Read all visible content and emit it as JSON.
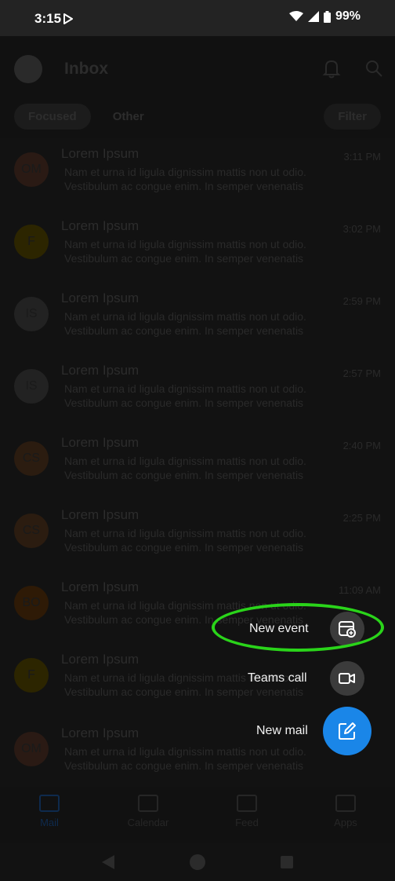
{
  "status_bar": {
    "time": "3:15",
    "battery": "99%"
  },
  "header": {
    "title": "Inbox",
    "tabs": [
      "Focused",
      "Other"
    ],
    "filter_label": "Filter"
  },
  "messages": [
    {
      "initials": "OM",
      "sender": "Lorem Ipsum",
      "time": "3:11 PM",
      "line1": "Nam et urna id ligula dignissim mattis non ut odio.",
      "line2": "Vestibulum ac congue enim. In semper venenatis",
      "color": "#2a1a14"
    },
    {
      "initials": "F",
      "sender": "Lorem Ipsum",
      "time": "3:02 PM",
      "line1": "Nam et urna id ligula dignissim mattis non ut odio.",
      "line2": "Vestibulum ac congue enim. In semper venenatis",
      "color": "#2c2500"
    },
    {
      "initials": "IS",
      "sender": "Lorem Ipsum",
      "time": "2:59 PM",
      "line1": "Nam et urna id ligula dignissim mattis non ut odio.",
      "line2": "Vestibulum ac congue enim. In semper venenatis",
      "color": "#222222"
    },
    {
      "initials": "IS",
      "sender": "Lorem Ipsum",
      "time": "2:57 PM",
      "line1": "Nam et urna id ligula dignissim mattis non ut odio.",
      "line2": "Vestibulum ac congue enim. In semper venenatis",
      "color": "#222222"
    },
    {
      "initials": "CS",
      "sender": "Lorem Ipsum",
      "time": "2:40 PM",
      "line1": "Nam et urna id ligula dignissim mattis non ut odio.",
      "line2": "Vestibulum ac congue enim. In semper venenatis",
      "color": "#2b1c10"
    },
    {
      "initials": "CS",
      "sender": "Lorem Ipsum",
      "time": "2:25 PM",
      "line1": "Nam et urna id ligula dignissim mattis non ut odio.",
      "line2": "Vestibulum ac congue enim. In semper venenatis",
      "color": "#2b1c10"
    },
    {
      "initials": "BO",
      "sender": "Lorem Ipsum",
      "time": "11:09 AM",
      "line1": "Nam et urna id ligula dignissim mattis non ut odio.",
      "line2": "Vestibulum ac congue enim. In semper venenatis",
      "color": "#2e1a06"
    },
    {
      "initials": "F",
      "sender": "Lorem Ipsum",
      "time": "",
      "line1": "Nam et urna id ligula dignissim mattis non ut odio.",
      "line2": "Vestibulum ac congue enim. In semper venenatis",
      "color": "#2c2500"
    },
    {
      "initials": "OM",
      "sender": "Lorem Ipsum",
      "time": "",
      "line1": "Nam et urna id ligula dignissim mattis non ut odio.",
      "line2": "Vestibulum ac congue enim. In semper venenatis",
      "color": "#2a1a14"
    }
  ],
  "bottom_nav": [
    "Mail",
    "Calendar",
    "Feed",
    "Apps"
  ],
  "fab_menu": {
    "new_event": "New event",
    "teams_call": "Teams call",
    "new_mail": "New mail"
  },
  "colors": {
    "fab_accent": "#1a86e8",
    "highlight": "#2ad41a"
  }
}
